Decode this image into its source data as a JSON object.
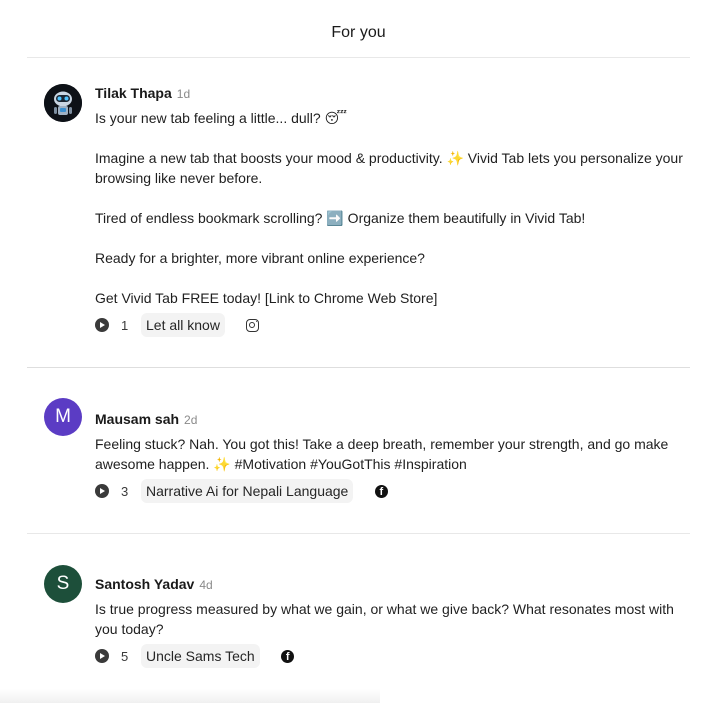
{
  "header": {
    "title": "For you"
  },
  "posts": [
    {
      "author": "Tilak Thapa",
      "time": "1d",
      "avatar_type": "robot-image",
      "paragraphs": [
        "Is your new tab feeling a little... dull? 😴",
        "Imagine a new tab that boosts your mood & productivity. ✨ Vivid Tab lets you personalize your browsing like never before.",
        "Tired of endless bookmark scrolling? ➡️ Organize them beautifully in Vivid Tab!",
        "Ready for a brighter, more vibrant online experience?",
        "Get Vivid Tab FREE today! [Link to Chrome Web Store]"
      ],
      "count": "1",
      "tag": "Let all know",
      "platform_icon": "instagram-icon"
    },
    {
      "author": "Mausam sah",
      "time": "2d",
      "avatar_letter": "M",
      "avatar_color": "#5b3cc4",
      "paragraphs": [
        "Feeling stuck? Nah. You got this! Take a deep breath, remember your strength, and go make awesome happen. ✨ #Motivation #YouGotThis #Inspiration"
      ],
      "count": "3",
      "tag": "Narrative Ai for Nepali Language",
      "platform_icon": "facebook-icon"
    },
    {
      "author": "Santosh Yadav",
      "time": "4d",
      "avatar_letter": "S",
      "avatar_color": "#1d4f3a",
      "paragraphs": [
        "Is true progress measured by what we gain, or what we give back? What resonates most with you today?"
      ],
      "count": "5",
      "tag": "Uncle Sams Tech",
      "platform_icon": "facebook-icon"
    }
  ]
}
